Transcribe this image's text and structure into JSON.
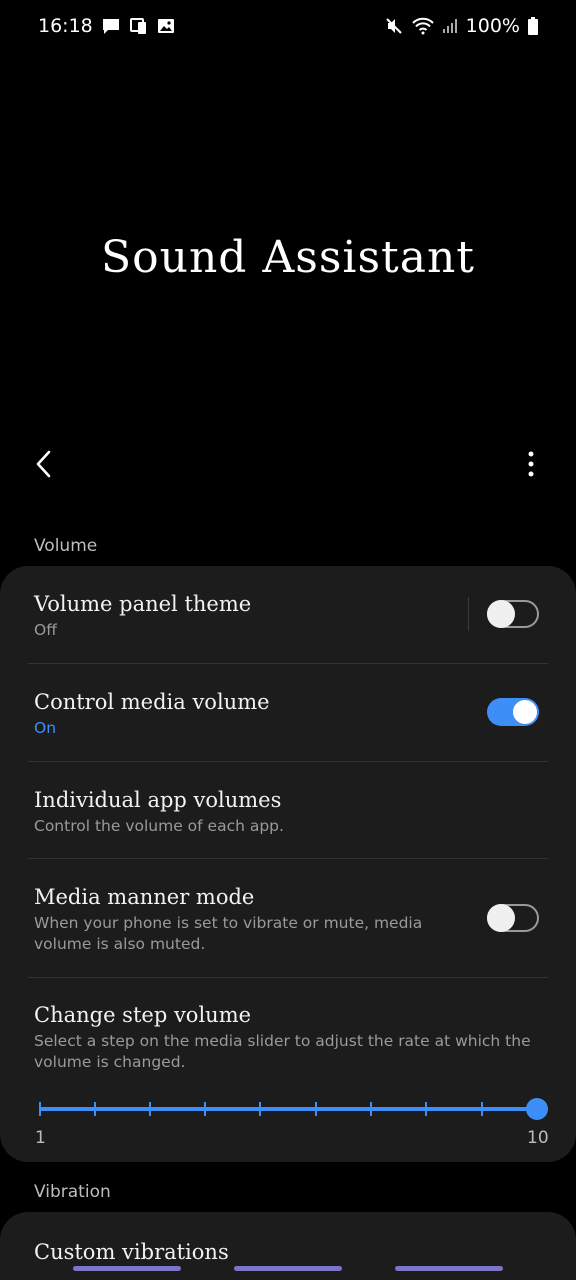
{
  "status_bar": {
    "time": "16:18",
    "battery": "100%"
  },
  "app_title": "Sound Assistant",
  "sections": {
    "volume_header": "Volume",
    "vibration_header": "Vibration"
  },
  "settings": {
    "volume_panel_theme": {
      "title": "Volume panel theme",
      "subtitle": "Off",
      "enabled": false
    },
    "control_media_volume": {
      "title": "Control media volume",
      "subtitle": "On",
      "enabled": true
    },
    "individual_app_volumes": {
      "title": "Individual app volumes",
      "subtitle": "Control the volume of each app."
    },
    "media_manner_mode": {
      "title": "Media manner mode",
      "subtitle": "When your phone is set to vibrate or mute, media volume is also muted.",
      "enabled": false
    },
    "change_step_volume": {
      "title": "Change step volume",
      "subtitle": "Select a step on the media slider to adjust the rate at which the volume is changed.",
      "min_label": "1",
      "max_label": "10",
      "value": 10
    },
    "custom_vibrations": {
      "title": "Custom vibrations"
    }
  },
  "colors": {
    "accent": "#3e8ef7",
    "card": "#1c1c1c",
    "background": "#000000"
  }
}
